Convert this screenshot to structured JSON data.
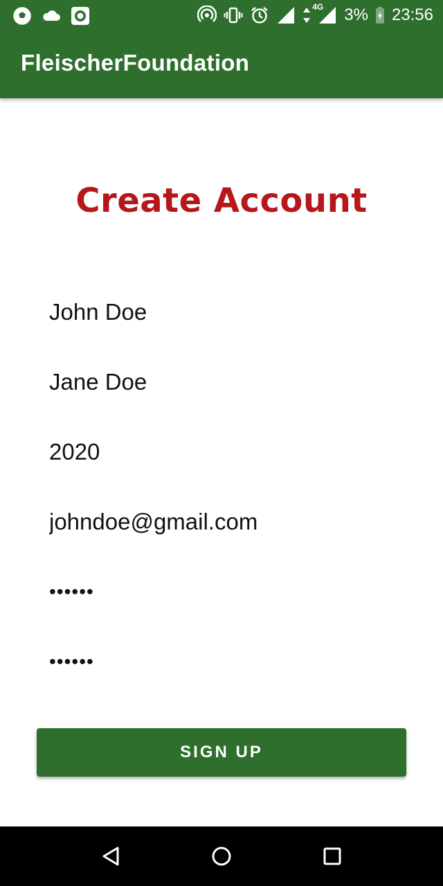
{
  "status_bar": {
    "battery": "3%",
    "time": "23:56",
    "network": "4G",
    "left_icons": [
      "soccer-ball-icon",
      "cloud-icon",
      "screen-record-icon"
    ],
    "right_icons": [
      "hotspot-icon",
      "vibrate-icon",
      "alarm-icon",
      "signal-icon",
      "data-arrows-icon",
      "signal-4g-icon",
      "battery-charging-icon"
    ]
  },
  "app_bar": {
    "title": "FleischerFoundation",
    "color": "#2e6f2e"
  },
  "form": {
    "heading": "Create Account",
    "heading_color": "#b5171b",
    "first_name": "John Doe",
    "last_name": "Jane Doe",
    "year": "2020",
    "email": "johndoe@gmail.com",
    "password": "••••••",
    "confirm_password": "••••••",
    "submit_label": "SIGN UP"
  },
  "nav_bar": {
    "icons": [
      "back-icon",
      "home-icon",
      "recents-icon"
    ]
  }
}
